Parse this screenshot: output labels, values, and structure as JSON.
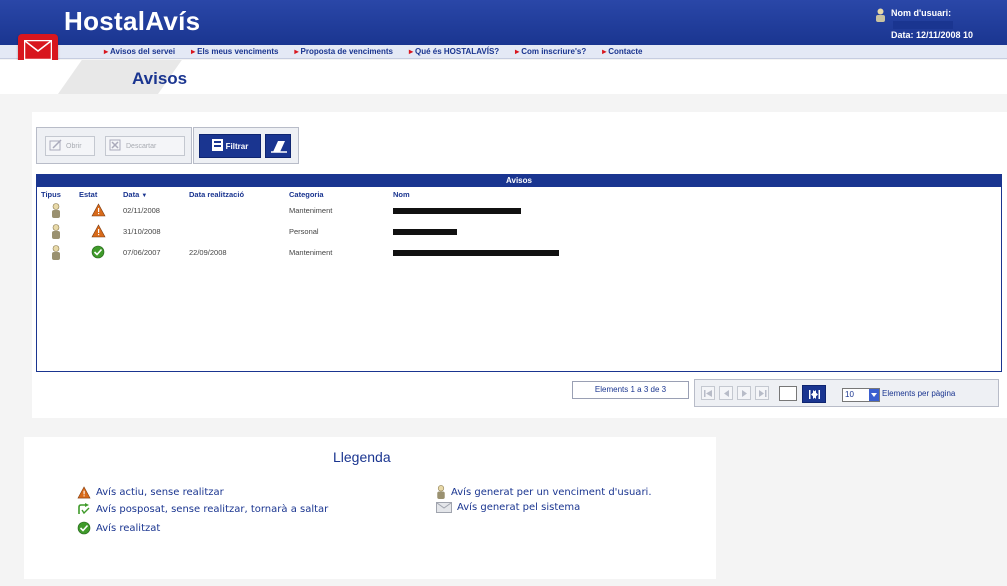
{
  "header": {
    "brand": "HostalAvís",
    "user_label": "Nom d'usuari:",
    "date_label": "Data: 12/11/2008 10"
  },
  "nav": {
    "items": [
      "Avisos del servei",
      "Els meus venciments",
      "Proposta de venciments",
      "Qué és HOSTALAVÍS?",
      "Com inscriure's?",
      "Contacte"
    ]
  },
  "page": {
    "title": "Avisos"
  },
  "toolbar": {
    "btn1_label": "Obrir",
    "btn2_label": "Descartar",
    "filter_label": "Filtrar"
  },
  "table": {
    "caption": "Avisos",
    "headers": {
      "tipus": "Tipus",
      "estat": "Estat",
      "data": "Data",
      "data_realitzacio": "Data realització",
      "categoria": "Categoria",
      "nom": "Nom"
    },
    "rows": [
      {
        "tipus_icon": "user-icon",
        "estat_icon": "warning-icon",
        "data": "02/11/2008",
        "data_realitzacio": "",
        "categoria": "Manteniment"
      },
      {
        "tipus_icon": "user-icon",
        "estat_icon": "warning-icon",
        "data": "31/10/2008",
        "data_realitzacio": "",
        "categoria": "Personal"
      },
      {
        "tipus_icon": "user-icon",
        "estat_icon": "check-icon",
        "data": "07/06/2007",
        "data_realitzacio": "22/09/2008",
        "categoria": "Manteniment"
      }
    ]
  },
  "pagination": {
    "count_text": "Elements 1 a 3 de 3",
    "per_page_value": "10",
    "per_page_label": "Elements per pàgina"
  },
  "legend": {
    "title": "Llegenda",
    "items": {
      "active": "Avís actiu, sense realitzar",
      "postponed": "Avís posposat, sense realitzar, tornarà a saltar",
      "done": "Avís realitzat",
      "user_generated": "Avís generat per un venciment d'usuari.",
      "system_generated": "Avís generat pel sistema"
    }
  },
  "colors": {
    "brand_blue": "#1a3590",
    "accent_red": "#d8161e",
    "warning_orange": "#d86a1a",
    "check_green": "#3f9a2a"
  }
}
